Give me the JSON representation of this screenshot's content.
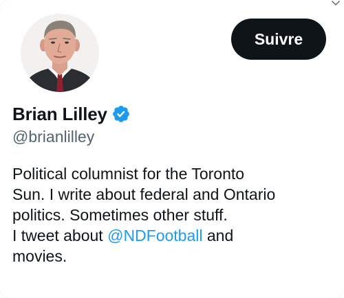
{
  "profile": {
    "display_name": "Brian Lilley",
    "handle": "@brianlilley",
    "verified": true,
    "follow_label": "Suivre",
    "bio": {
      "line1": "Political columnist for the Toronto",
      "line2": "Sun. I write about federal and Ontario",
      "line3": "politics. Sometimes other stuff.",
      "line4_prefix": "I tweet about ",
      "mention": "@NDFootball",
      "line4_suffix": " and",
      "line5": "movies."
    }
  },
  "colors": {
    "text": "#0f1419",
    "secondary_text": "#536471",
    "link": "#1d9bf0",
    "verified_badge": "#1d9bf0",
    "follow_button_bg": "#0f1419",
    "follow_button_text": "#ffffff"
  },
  "icons": {
    "verified": "verified-badge-icon",
    "corner": "chevron-down-icon"
  }
}
